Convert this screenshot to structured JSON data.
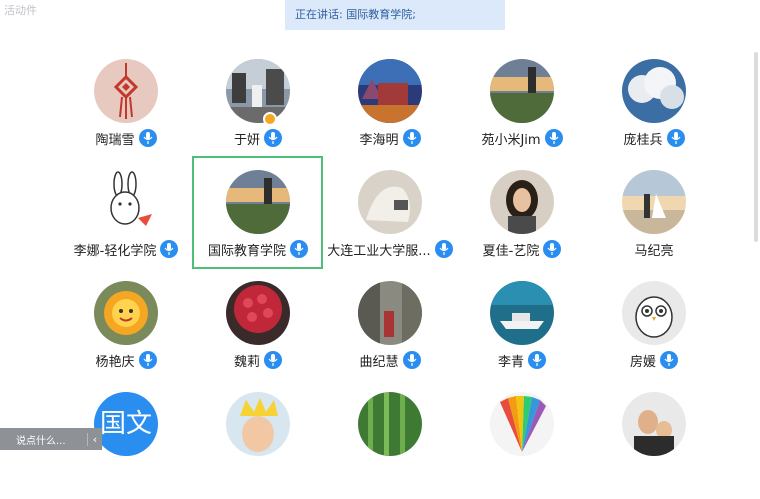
{
  "corner_label": "活动件",
  "speaking": "正在讲话: 国际教育学院;",
  "chat": {
    "placeholder": "说点什么...",
    "chevron": "‹"
  },
  "participants": [
    {
      "name": "陶瑞雪",
      "avatar": "chinese-knot-icon",
      "mic": true
    },
    {
      "name": "于妍",
      "avatar": "photo-street",
      "mic": true,
      "badge": true
    },
    {
      "name": "李海明",
      "avatar": "photo-night-building",
      "mic": true
    },
    {
      "name": "苑小米Jim",
      "avatar": "photo-tower-sunset",
      "mic": true
    },
    {
      "name": "庞桂兵",
      "avatar": "photo-clouds",
      "mic": true
    },
    {
      "name": "李娜-轻化学院",
      "avatar": "cartoon-rabbit-icon",
      "mic": true
    },
    {
      "name": "国际教育学院",
      "avatar": "photo-tower-sunset",
      "mic": true,
      "selected": true
    },
    {
      "name": "大连工业大学服...",
      "avatar": "photo-sculpture",
      "mic": true
    },
    {
      "name": "夏佳-艺院",
      "avatar": "photo-girl",
      "mic": true
    },
    {
      "name": "马纪亮",
      "avatar": "photo-wedding",
      "mic": false
    },
    {
      "name": "杨艳庆",
      "avatar": "sun-flower-icon",
      "mic": true
    },
    {
      "name": "魏莉",
      "avatar": "photo-roses",
      "mic": true
    },
    {
      "name": "曲纪慧",
      "avatar": "photo-alley",
      "mic": true
    },
    {
      "name": "李青",
      "avatar": "photo-ship",
      "mic": true
    },
    {
      "name": "房媛",
      "avatar": "cartoon-owl-icon",
      "mic": true
    },
    {
      "name": "",
      "avatar": "guowen",
      "avatar_text": "国文",
      "mic": false
    },
    {
      "name": "",
      "avatar": "photo-baby-crown",
      "mic": false
    },
    {
      "name": "",
      "avatar": "photo-bamboo",
      "mic": false
    },
    {
      "name": "",
      "avatar": "color-fan",
      "mic": false
    },
    {
      "name": "",
      "avatar": "photo-father-son",
      "mic": false
    }
  ],
  "colors": {
    "mic": "#2a8ef0",
    "selected_border": "#4dbf77",
    "speaking_bg": "#dbe9fb"
  }
}
